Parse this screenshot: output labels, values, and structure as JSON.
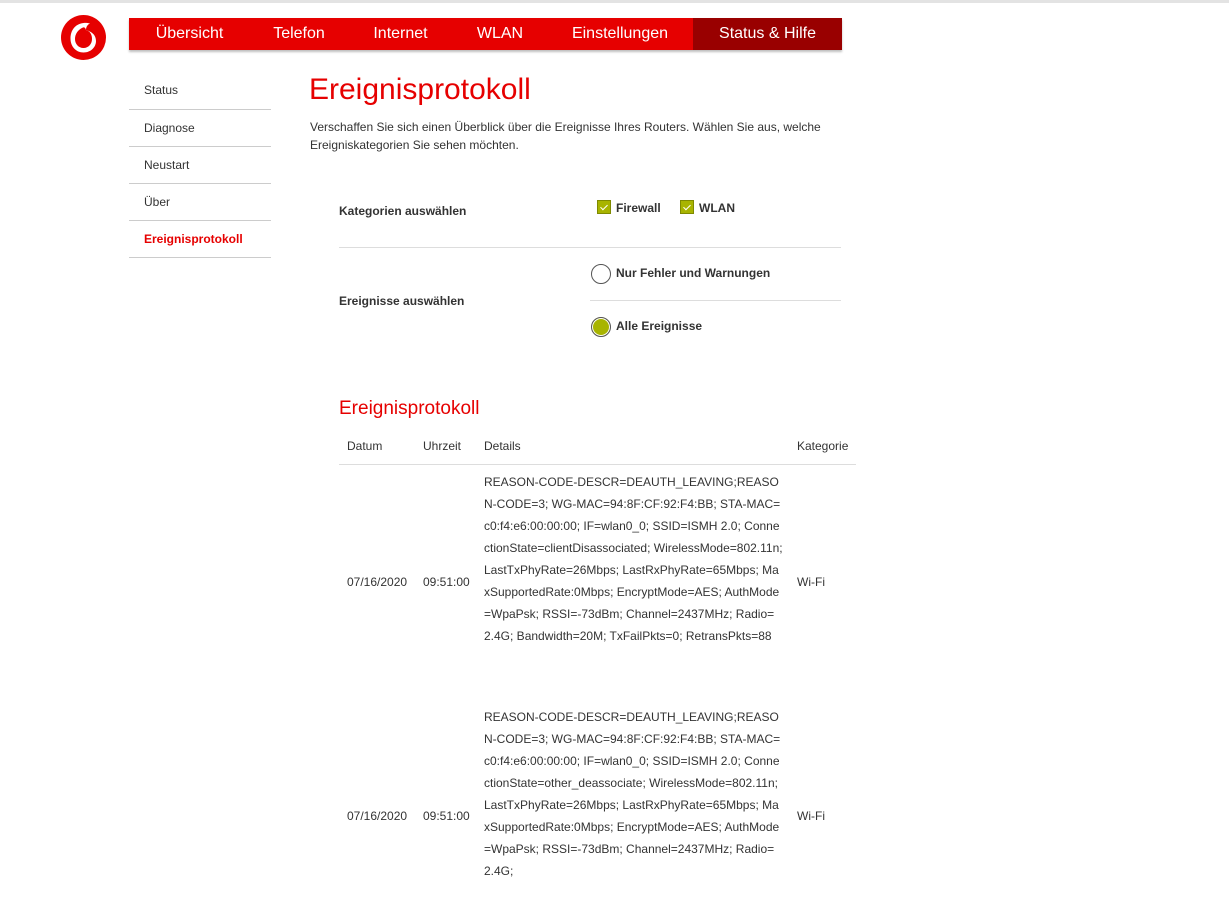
{
  "nav": {
    "items": [
      {
        "label": "Übersicht"
      },
      {
        "label": "Telefon"
      },
      {
        "label": "Internet"
      },
      {
        "label": "WLAN"
      },
      {
        "label": "Einstellungen"
      },
      {
        "label": "Status & Hilfe"
      }
    ],
    "active": "Status & Hilfe"
  },
  "sidebar": {
    "items": [
      {
        "label": "Status"
      },
      {
        "label": "Diagnose"
      },
      {
        "label": "Neustart"
      },
      {
        "label": "Über"
      },
      {
        "label": "Ereignisprotokoll"
      }
    ],
    "active": "Ereignisprotokoll"
  },
  "page": {
    "title": "Ereignisprotokoll",
    "intro": "Verschaffen Sie sich einen Überblick über die Ereignisse Ihres Routers. Wählen Sie aus, welche Ereigniskategorien Sie sehen möchten."
  },
  "filters": {
    "categories_label": "Kategorien auswählen",
    "categories": [
      {
        "label": "Firewall",
        "checked": true
      },
      {
        "label": "WLAN",
        "checked": true
      }
    ],
    "events_label": "Ereignisse auswählen",
    "events": [
      {
        "label": "Nur Fehler und Warnungen",
        "selected": false
      },
      {
        "label": "Alle Ereignisse",
        "selected": true
      }
    ]
  },
  "log": {
    "heading": "Ereignisprotokoll",
    "columns": [
      "Datum",
      "Uhrzeit",
      "Details",
      "Kategorie"
    ],
    "rows": [
      {
        "date": "07/16/2020",
        "time": "09:51:00",
        "details": "REASON-CODE-DESCR=DEAUTH_LEAVING;REASON-CODE=3; WG-MAC=94:8F:CF:92:F4:BB; STA-MAC=c0:f4:e6:00:00:00; IF=wlan0_0; SSID=ISMH 2.0; ConnectionState=clientDisassociated; WirelessMode=802.11n; LastTxPhyRate=26Mbps; LastRxPhyRate=65Mbps; MaxSupportedRate:0Mbps; EncryptMode=AES; AuthMode=WpaPsk; RSSI=-73dBm; Channel=2437MHz; Radio=2.4G; Bandwidth=20M; TxFailPkts=0; RetransPkts=88",
        "category": "Wi-Fi"
      },
      {
        "date": "07/16/2020",
        "time": "09:51:00",
        "details": "REASON-CODE-DESCR=DEAUTH_LEAVING;REASON-CODE=3; WG-MAC=94:8F:CF:92:F4:BB; STA-MAC=c0:f4:e6:00:00:00; IF=wlan0_0; SSID=ISMH 2.0; ConnectionState=other_deassociate; WirelessMode=802.11n; LastTxPhyRate=26Mbps; LastRxPhyRate=65Mbps; MaxSupportedRate:0Mbps; EncryptMode=AES; AuthMode=WpaPsk; RSSI=-73dBm; Channel=2437MHz; Radio=2.4G;",
        "category": "Wi-Fi"
      }
    ]
  },
  "colors": {
    "brand_red": "#e60000",
    "active_nav": "#990000",
    "check_green": "#a8b400"
  }
}
